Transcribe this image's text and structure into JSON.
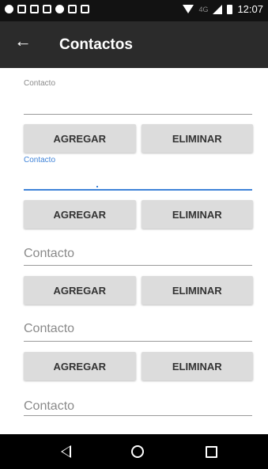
{
  "status_bar": {
    "network": "4G",
    "time": "12:07",
    "icons": [
      "messenger-icon",
      "notes-icon",
      "gmail-icon",
      "image-icon",
      "messenger-icon",
      "gmail-icon",
      "flag-icon"
    ]
  },
  "app_bar": {
    "title": "Contactos",
    "back_icon": "arrow-back-icon"
  },
  "fields": [
    {
      "label": "Contacto",
      "value": "",
      "state": "filled-label"
    },
    {
      "label": "Contacto",
      "value": "",
      "state": "focused"
    },
    {
      "placeholder": "Contacto",
      "value": ""
    },
    {
      "placeholder": "Contacto",
      "value": ""
    },
    {
      "placeholder": "Contacto",
      "value": ""
    }
  ],
  "buttons": {
    "add_label": "AGREGAR",
    "remove_label": "ELIMINAR"
  },
  "nav_bar": {
    "icons": [
      "nav-back-icon",
      "nav-home-icon",
      "nav-recents-icon"
    ]
  },
  "colors": {
    "accent": "#3f83d8",
    "app_bar": "#2b2b2b",
    "button": "#dcdcdc"
  }
}
